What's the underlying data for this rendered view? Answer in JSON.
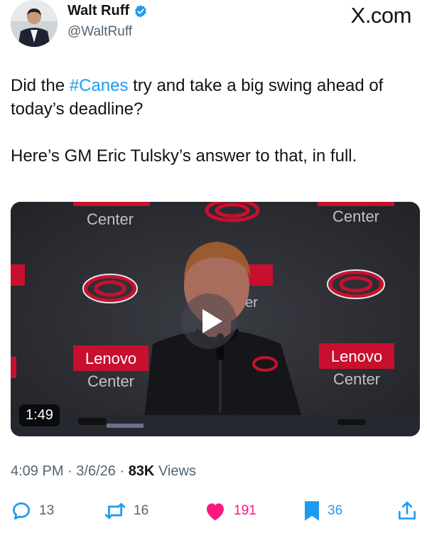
{
  "author": {
    "display_name": "Walt Ruff",
    "handle": "@WaltRuff",
    "verified_icon": "verified-badge-icon"
  },
  "brand": "X.com",
  "tweet": {
    "line1_before": "Did the ",
    "hashtag": "#Canes",
    "line1_after": " try and take a big swing ahead of today’s deadline?",
    "line2": "Here’s GM Eric Tulsky’s answer to that, in full."
  },
  "video": {
    "duration": "1:49",
    "banner_texts": [
      "Center",
      "Center",
      "Lenovo",
      "Center",
      "Lenovo",
      "Center",
      "er"
    ]
  },
  "meta": {
    "time": "4:09 PM",
    "date": "3/6/26",
    "views_count": "83K",
    "views_label": "Views",
    "separator": "·"
  },
  "actions": {
    "replies": "13",
    "reposts": "16",
    "likes": "191",
    "bookmarks": "36"
  },
  "colors": {
    "accent": "#1d9bf0",
    "like": "#f91880",
    "muted": "#536471",
    "text": "#0f1419",
    "canes_red": "#c8102e"
  }
}
